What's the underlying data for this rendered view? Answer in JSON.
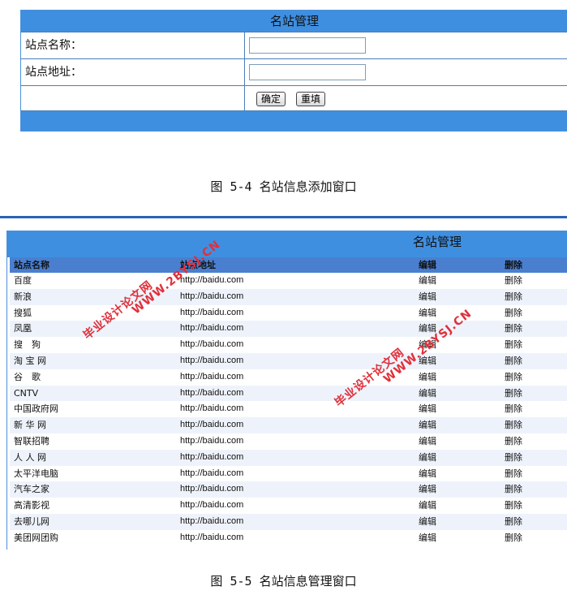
{
  "form": {
    "title": "名站管理",
    "name_label": "站点名称：",
    "name_value": "",
    "url_label": "站点地址：",
    "url_value": "",
    "confirm_label": "确定",
    "reset_label": "重填"
  },
  "caption1": "图 5-4 名站信息添加窗口",
  "table": {
    "title": "名站管理",
    "headers": [
      "站点名称",
      "站点地址",
      "编辑",
      "删除"
    ],
    "rows": [
      {
        "name": "百度",
        "url": "http://baidu.com",
        "edit": "编辑",
        "del": "删除"
      },
      {
        "name": "新浪",
        "url": "http://baidu.com",
        "edit": "编辑",
        "del": "删除"
      },
      {
        "name": "搜狐",
        "url": "http://baidu.com",
        "edit": "编辑",
        "del": "删除"
      },
      {
        "name": "凤凰",
        "url": "http://baidu.com",
        "edit": "编辑",
        "del": "删除"
      },
      {
        "name": "搜　狗",
        "url": "http://baidu.com",
        "edit": "编辑",
        "del": "删除"
      },
      {
        "name": "淘 宝 网",
        "url": "http://baidu.com",
        "edit": "编辑",
        "del": "删除"
      },
      {
        "name": "谷　歌",
        "url": "http://baidu.com",
        "edit": "编辑",
        "del": "删除"
      },
      {
        "name": "CNTV",
        "url": "http://baidu.com",
        "edit": "编辑",
        "del": "删除"
      },
      {
        "name": "中国政府网",
        "url": "http://baidu.com",
        "edit": "编辑",
        "del": "删除"
      },
      {
        "name": "新 华 网",
        "url": "http://baidu.com",
        "edit": "编辑",
        "del": "删除"
      },
      {
        "name": "智联招聘",
        "url": "http://baidu.com",
        "edit": "编辑",
        "del": "删除"
      },
      {
        "name": "人 人 网",
        "url": "http://baidu.com",
        "edit": "编辑",
        "del": "删除"
      },
      {
        "name": "太平洋电脑",
        "url": "http://baidu.com",
        "edit": "编辑",
        "del": "删除"
      },
      {
        "name": "汽车之家",
        "url": "http://baidu.com",
        "edit": "编辑",
        "del": "删除"
      },
      {
        "name": "高清影视",
        "url": "http://baidu.com",
        "edit": "编辑",
        "del": "删除"
      },
      {
        "name": "去哪儿网",
        "url": "http://baidu.com",
        "edit": "编辑",
        "del": "删除"
      },
      {
        "name": "美团网团购",
        "url": "http://baidu.com",
        "edit": "编辑",
        "del": "删除"
      }
    ]
  },
  "caption2": "图 5-5 名站信息管理窗口",
  "watermarks": {
    "text1": "毕业设计论文网",
    "text2": "WWW.2BYSJ.CN"
  }
}
